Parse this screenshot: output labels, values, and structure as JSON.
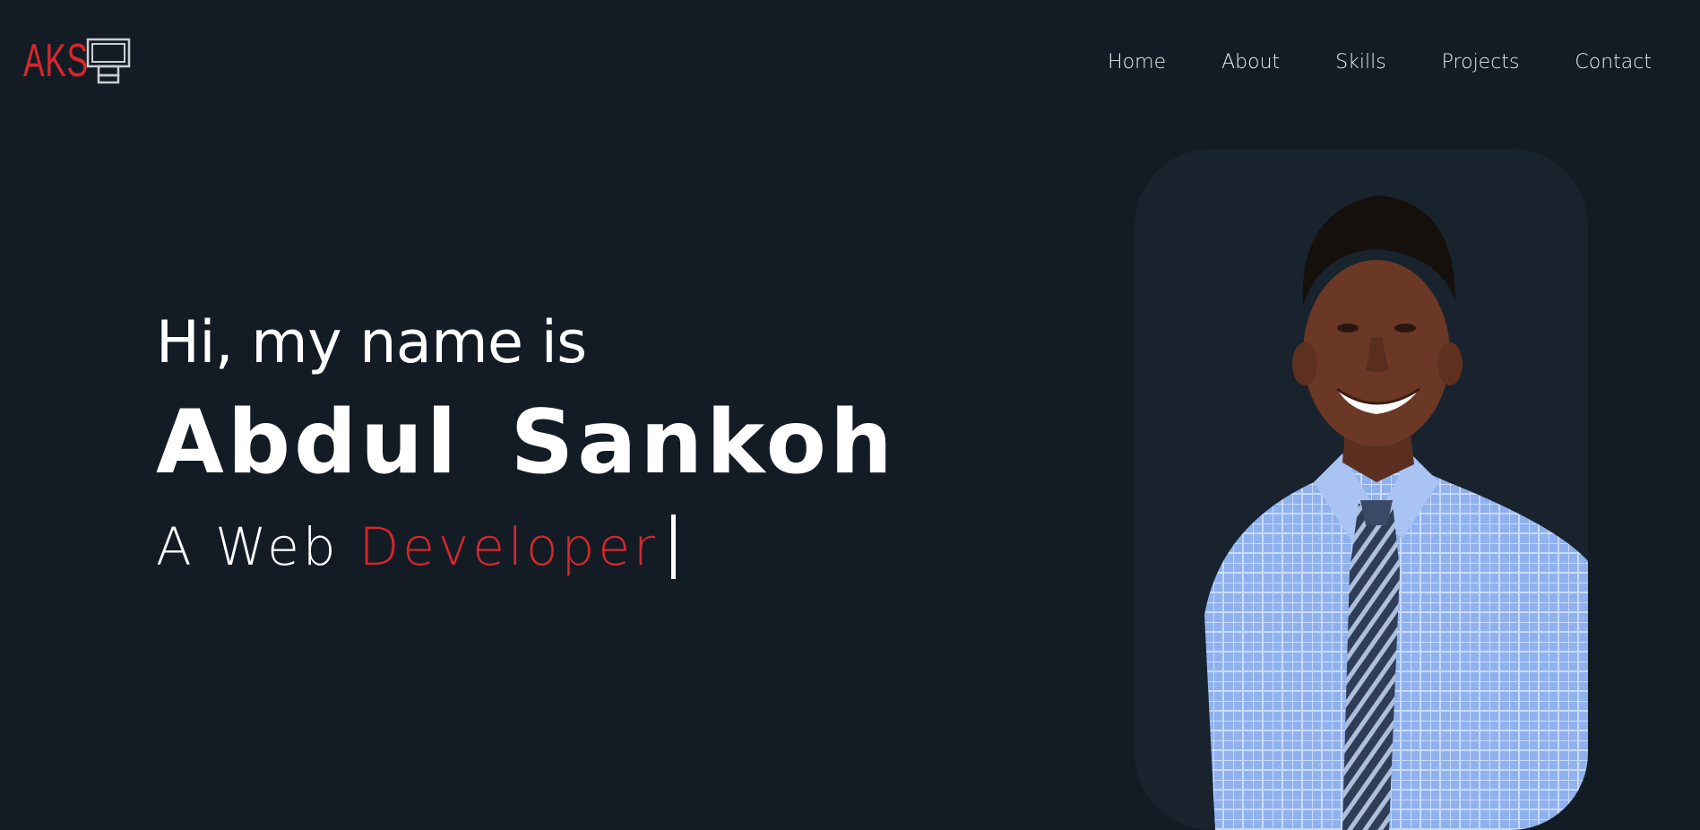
{
  "logo": {
    "text": "AKS",
    "icon": "monitor-icon",
    "color": "#d7262c"
  },
  "nav": {
    "items": [
      {
        "label": "Home"
      },
      {
        "label": "About"
      },
      {
        "label": "Skills"
      },
      {
        "label": "Projects"
      },
      {
        "label": "Contact"
      }
    ]
  },
  "hero": {
    "greeting": "Hi, my name is",
    "name": "Abdul Sankoh",
    "role_prefix": "A Web",
    "role_typed": "Developer",
    "accent_color": "#d7262c"
  },
  "photo": {
    "subject": "portrait-photo"
  }
}
